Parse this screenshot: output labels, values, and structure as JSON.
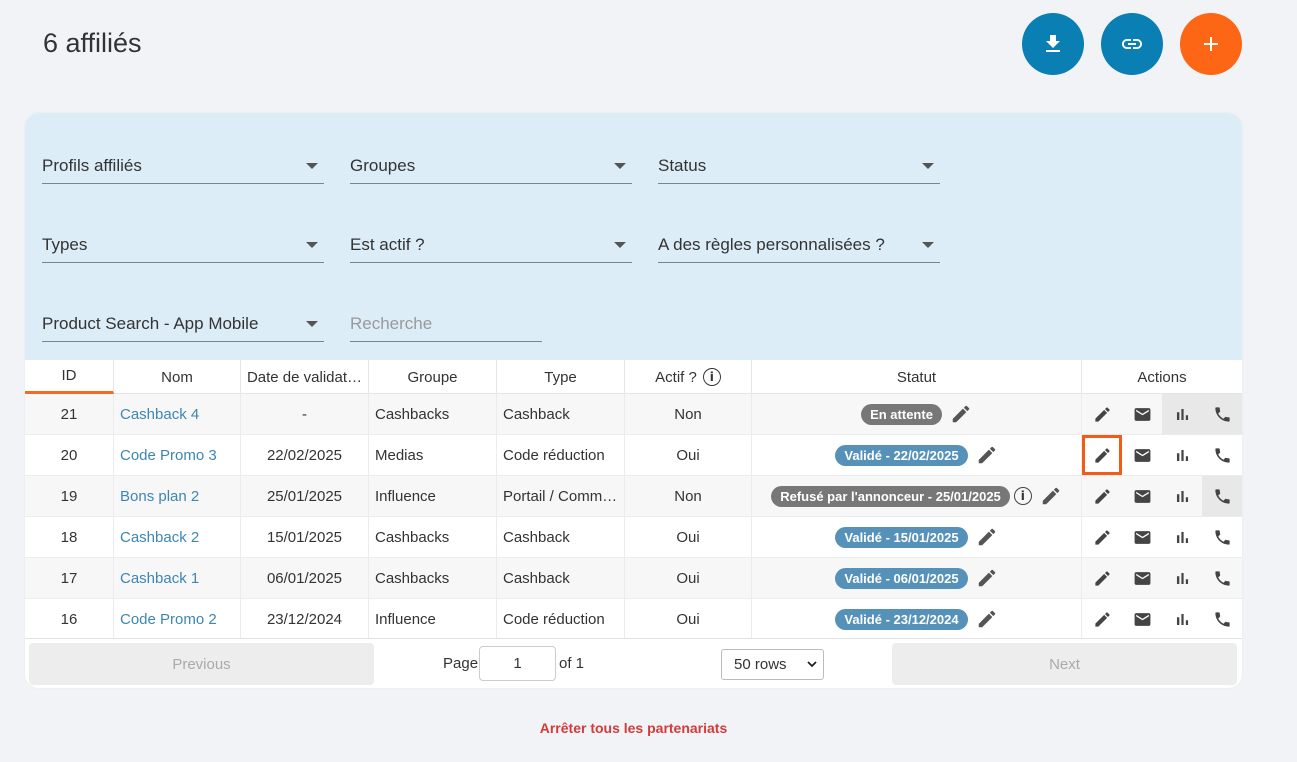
{
  "title": "6 affiliés",
  "fabs": [
    {
      "name": "download-button",
      "icon": "download-icon",
      "color": "#0a7fb3"
    },
    {
      "name": "link-button",
      "icon": "link-icon",
      "color": "#0a7fb3"
    },
    {
      "name": "add-button",
      "icon": "plus-icon",
      "color": "#fd6614"
    }
  ],
  "filters": {
    "profils": "Profils affiliés",
    "groupes": "Groupes",
    "status": "Status",
    "types": "Types",
    "est_actif": "Est actif ?",
    "regles": "A des règles personnalisées ?",
    "product_search": "Product Search - App Mobile",
    "recherche_placeholder": "Recherche"
  },
  "columns": {
    "id": "ID",
    "nom": "Nom",
    "date": "Date de validat…",
    "groupe": "Groupe",
    "type": "Type",
    "actif": "Actif ?",
    "statut": "Statut",
    "actions": "Actions"
  },
  "rows": [
    {
      "id": "21",
      "nom": "Cashback 4",
      "date": "-",
      "groupe": "Cashbacks",
      "type": "Cashback",
      "actif": "Non",
      "statut": "En attente",
      "statut_color": "grey",
      "info": false
    },
    {
      "id": "20",
      "nom": "Code Promo 3",
      "date": "22/02/2025",
      "groupe": "Medias",
      "type": "Code réduction",
      "actif": "Oui",
      "statut": "Validé - 22/02/2025",
      "statut_color": "blue",
      "info": false
    },
    {
      "id": "19",
      "nom": "Bons plan 2",
      "date": "25/01/2025",
      "groupe": "Influence",
      "type": "Portail / Comm…",
      "actif": "Non",
      "statut": "Refusé par l'annonceur - 25/01/2025",
      "statut_color": "grey",
      "info": true
    },
    {
      "id": "18",
      "nom": "Cashback 2",
      "date": "15/01/2025",
      "groupe": "Cashbacks",
      "type": "Cashback",
      "actif": "Oui",
      "statut": "Validé - 15/01/2025",
      "statut_color": "blue",
      "info": false
    },
    {
      "id": "17",
      "nom": "Cashback 1",
      "date": "06/01/2025",
      "groupe": "Cashbacks",
      "type": "Cashback",
      "actif": "Oui",
      "statut": "Validé - 06/01/2025",
      "statut_color": "blue",
      "info": false
    },
    {
      "id": "16",
      "nom": "Code Promo 2",
      "date": "23/12/2024",
      "groupe": "Influence",
      "type": "Code réduction",
      "actif": "Oui",
      "statut": "Validé - 23/12/2024",
      "statut_color": "blue",
      "info": false
    }
  ],
  "action_icons": [
    "pencil-icon",
    "mail-icon",
    "bar-chart-icon",
    "phone-icon"
  ],
  "pager": {
    "previous": "Previous",
    "page_label": "Page",
    "page_value": "1",
    "of_label": "of 1",
    "rows_option": "50 rows",
    "next": "Next"
  },
  "stop_link": "Arrêter tous les partenariats"
}
